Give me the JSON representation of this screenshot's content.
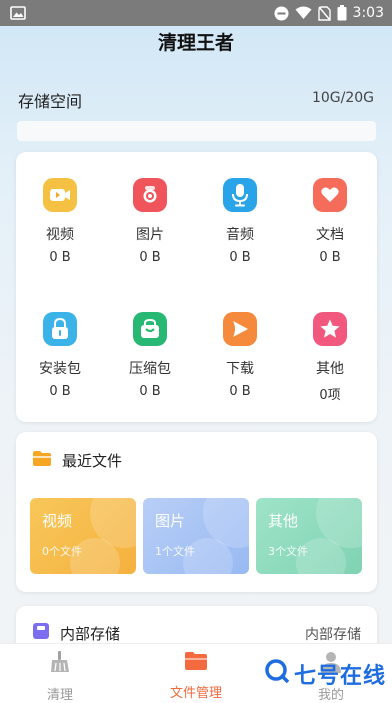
{
  "status_bar": {
    "time": "3:03",
    "icons": [
      "image-icon",
      "dnd-icon",
      "wifi-icon",
      "no-sim-icon",
      "battery-icon"
    ]
  },
  "app": {
    "title": "清理王者"
  },
  "storage": {
    "label": "存储空间",
    "value": "10G/20G"
  },
  "categories": [
    {
      "name": "视频",
      "count": "0 B",
      "icon": "video-icon",
      "color": "#f5c142"
    },
    {
      "name": "图片",
      "count": "0 B",
      "icon": "camera-icon",
      "color": "#f0555b"
    },
    {
      "name": "音频",
      "count": "0 B",
      "icon": "microphone-icon",
      "color": "#2aa4e8"
    },
    {
      "name": "文档",
      "count": "0 B",
      "icon": "heart-document-icon",
      "color": "#f56c5b"
    },
    {
      "name": "安装包",
      "count": "0 B",
      "icon": "lock-package-icon",
      "color": "#3bb3e8"
    },
    {
      "name": "压缩包",
      "count": "0 B",
      "icon": "bag-icon",
      "color": "#27b874"
    },
    {
      "name": "下载",
      "count": "0 B",
      "icon": "download-play-icon",
      "color": "#f58a3c"
    },
    {
      "name": "其他",
      "count": "0项",
      "icon": "star-icon",
      "color": "#f2587e"
    }
  ],
  "recent": {
    "title": "最近文件",
    "tiles": [
      {
        "name": "视频",
        "count": "0个文件",
        "color": "#f6bb47"
      },
      {
        "name": "图片",
        "count": "1个文件",
        "color": "#a7c5f5"
      },
      {
        "name": "其他",
        "count": "3个文件",
        "color": "#8fdcbf"
      }
    ]
  },
  "internal": {
    "title": "内部存储",
    "right_label": "内部存储"
  },
  "nav": [
    {
      "label": "清理",
      "icon": "broom-icon",
      "active": false
    },
    {
      "label": "文件管理",
      "icon": "folder-icon",
      "active": true
    },
    {
      "label": "我的",
      "icon": "user-icon",
      "active": false
    }
  ],
  "colors": {
    "accent": "#f26a3d",
    "inactive": "#999999",
    "watermark": "#1e6de0"
  },
  "watermark": {
    "text": "七号在线"
  }
}
